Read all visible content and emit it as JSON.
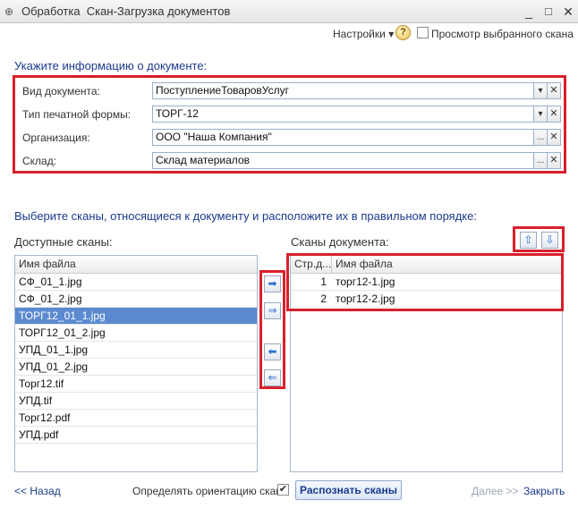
{
  "window": {
    "title": "Обработка  Скан-Загрузка документов",
    "minimize": "_",
    "maximize": "□",
    "close": "✕"
  },
  "toolbar": {
    "settings_label": "Настройки",
    "settings_caret": "▾",
    "help_label": "?",
    "preview_label": "Просмотр выбранного скана",
    "preview_checked": false
  },
  "doc_info": {
    "heading": "Укажите информацию о документе:",
    "fields": [
      {
        "label": "Вид документа:",
        "value": "ПоступлениеТоваровУслуг",
        "button": "▾"
      },
      {
        "label": "Тип печатной формы:",
        "value": "ТОРГ-12",
        "button": "▾"
      },
      {
        "label": "Организация:",
        "value": "ООО \"Наша Компания\"",
        "button": "..."
      },
      {
        "label": "Склад:",
        "value": "Склад материалов",
        "button": "..."
      }
    ],
    "clear_glyph": "✕"
  },
  "scans": {
    "heading": "Выберите сканы, относящиеся к документу и расположите их в правильном порядке:",
    "available": {
      "title": "Доступные сканы:",
      "column": "Имя файла",
      "items": [
        "СФ_01_1.jpg",
        "СФ_01_2.jpg",
        "ТОРГ12_01_1.jpg",
        "ТОРГ12_01_2.jpg",
        "УПД_01_1.jpg",
        "УПД_01_2.jpg",
        "Торг12.tif",
        "УПД.tif",
        "Торг12.pdf",
        "УПД.pdf"
      ],
      "selected_index": 2
    },
    "document": {
      "title": "Сканы документа:",
      "columns": [
        "Стр.д...",
        "Имя файла"
      ],
      "rows": [
        {
          "page": "1",
          "file": "торг12-1.jpg"
        },
        {
          "page": "2",
          "file": "торг12-2.jpg"
        }
      ]
    },
    "move_buttons": {
      "add": "➡",
      "add_all": "⇒",
      "remove": "⬅",
      "remove_all": "⇐"
    },
    "order_buttons": {
      "up": "⇧",
      "down": "⇩"
    }
  },
  "footer": {
    "back": "<< Назад",
    "orientation_label": "Определять ориентацию скана",
    "orientation_checked": true,
    "recognize": "Распознать сканы",
    "next": "Далее >>",
    "close": "Закрыть"
  }
}
